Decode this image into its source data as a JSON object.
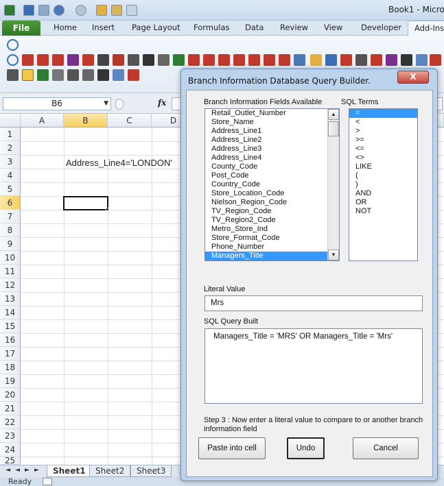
{
  "window": {
    "title": "Book1 - Micro"
  },
  "ribbon": {
    "file_tab": "File",
    "tabs": [
      "Home",
      "Insert",
      "Page Layout",
      "Formulas",
      "Data",
      "Review",
      "View",
      "Developer",
      "Add-Ins"
    ],
    "active_tab": "Add-Ins"
  },
  "formula_bar": {
    "name_box": "B6",
    "fx_label": "fx",
    "formula": ""
  },
  "sheet": {
    "columns": [
      "A",
      "B",
      "C",
      "D"
    ],
    "selected_column": "B",
    "rows": [
      "1",
      "2",
      "3",
      "4",
      "5",
      "6",
      "7",
      "8",
      "9",
      "10",
      "11",
      "12",
      "13",
      "14",
      "15",
      "16",
      "17",
      "18",
      "19",
      "20",
      "21",
      "22",
      "23",
      "24",
      "25"
    ],
    "selected_row": "6",
    "cell_b3": "Address_Line4='LONDON'",
    "active_cell": "B6"
  },
  "sheet_tabs": [
    "Sheet1",
    "Sheet2",
    "Sheet3"
  ],
  "active_sheet": "Sheet1",
  "status": {
    "text": "Ready"
  },
  "dialog": {
    "title": "Branch Information Database Query Builder.",
    "close_label": "X",
    "fields_label": "Branch Information Fields Available",
    "fields": [
      "Retail_Outlet_Number",
      "Store_Name",
      "Address_Line1",
      "Address_Line2",
      "Address_Line3",
      "Address_Line4",
      "County_Code",
      "Post_Code",
      "Country_Code",
      "Store_Location_Code",
      "Nielson_Region_Code",
      "TV_Region_Code",
      "TV_Region2_Code",
      "Metro_Store_Ind",
      "Store_Format_Code",
      "Phone_Number",
      "Managers_Title"
    ],
    "selected_field": "Managers_Title",
    "sql_terms_label": "SQL Terms",
    "sql_terms": [
      "=",
      "<",
      ">",
      ">=",
      "<=",
      "<>",
      "LIKE",
      "(",
      ")",
      "AND",
      "OR",
      "NOT"
    ],
    "selected_term": "=",
    "literal_label": "Literal Value",
    "literal_value": "Mrs",
    "query_label": "SQL Query Built",
    "query_text": "Managers_Title = 'MRS' OR Managers_Title = 'Mrs'",
    "step_text": "Step 3 : Now enter a literal value to compare to or another branch information field",
    "buttons": {
      "paste": "Paste into cell",
      "undo": "Undo",
      "cancel": "Cancel"
    }
  }
}
